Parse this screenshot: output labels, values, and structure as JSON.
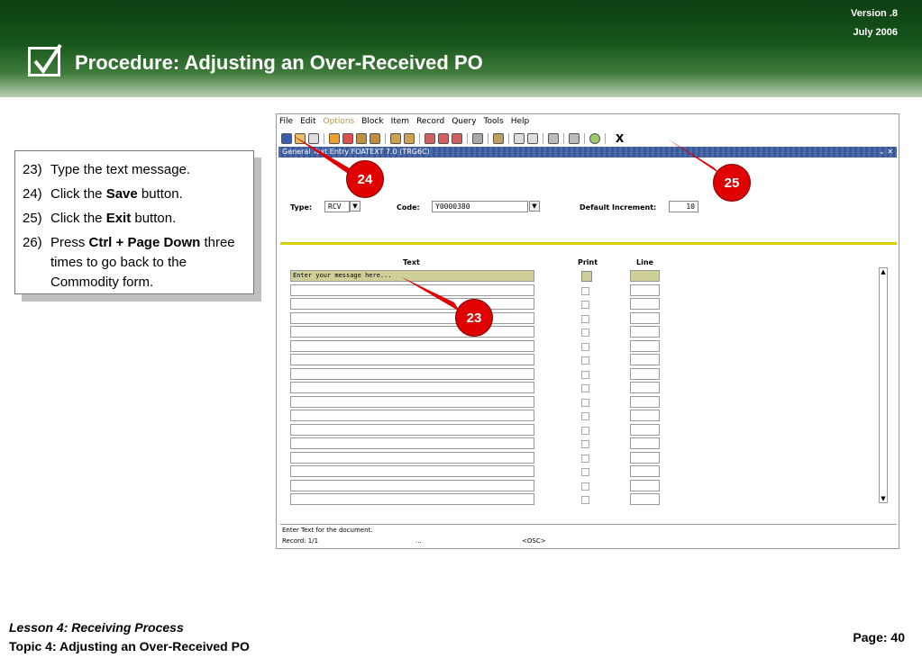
{
  "header": {
    "version": "Version .8",
    "date": "July  2006",
    "title": "Procedure:  Adjusting an Over-Received PO"
  },
  "steps": [
    {
      "num": "23)",
      "pre": "Type the text message.",
      "bold": "",
      "post": ""
    },
    {
      "num": "24)",
      "pre": "Click the ",
      "bold": "Save",
      "post": " button."
    },
    {
      "num": "25)",
      "pre": "Click the ",
      "bold": "Exit",
      "post": " button."
    },
    {
      "num": "26)",
      "pre": "Press ",
      "bold": "Ctrl + Page Down",
      "post": " three times to go back to the Commodity form."
    }
  ],
  "callouts": [
    "24",
    "25",
    "23"
  ],
  "app": {
    "menu": [
      "File",
      "Edit",
      "Options",
      "Block",
      "Item",
      "Record",
      "Query",
      "Tools",
      "Help"
    ],
    "exit_label": "X",
    "form_title": "General Text Entry  FOATEXT  7.0  (TRG6C)",
    "type_label": "Type:",
    "type_value": "RCV",
    "code_label": "Code:",
    "code_value": "Y0000380",
    "increment_label": "Default Increment:",
    "increment_value": "10",
    "col_text": "Text",
    "col_print": "Print",
    "col_line": "Line",
    "first_row_text": "Enter your message here...",
    "status_message": "Enter Text for the document.",
    "record": "Record: 1/1",
    "osc": "<OSC>",
    "ellipsis": "..."
  },
  "footer": {
    "lesson": "Lesson 4: Receiving Process",
    "topic": "Topic 4: Adjusting an Over-Received PO",
    "page": "Page: 40"
  },
  "colors": {
    "callout": "#e00000",
    "header_green": "#17561c",
    "highlight": "#cfcf99"
  }
}
